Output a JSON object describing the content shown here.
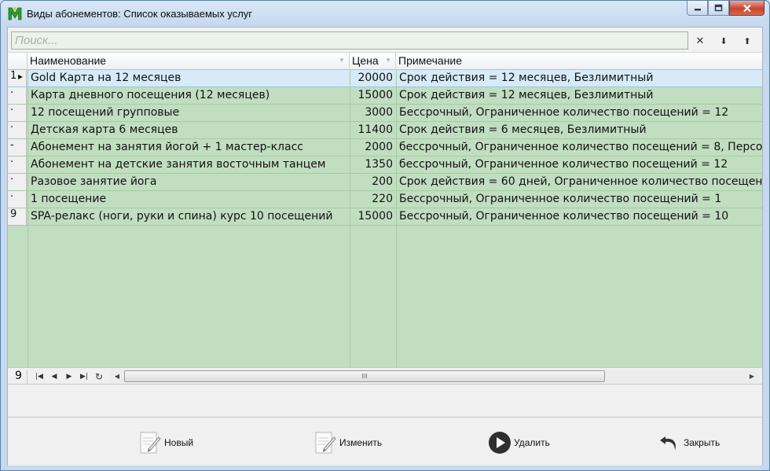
{
  "window": {
    "title": "Виды абонементов: Список оказываемых услуг",
    "app_icon": "app-logo-icon"
  },
  "search": {
    "placeholder": "Поиск...",
    "value": "",
    "clear_glyph": "✕",
    "down_glyph": "⬇",
    "up_glyph": "⬆"
  },
  "grid": {
    "columns": [
      "Наименование",
      "Цена",
      "Примечание"
    ],
    "rows": [
      {
        "indicator": "1",
        "name": "Gold Карта на 12 месяцев",
        "price": "20000",
        "note": "Срок действия = 12 месяцев, Безлимитный",
        "selected": true
      },
      {
        "indicator": "·",
        "name": "Карта дневного посещения (12 месяцев)",
        "price": "15000",
        "note": "Срок действия = 12 месяцев, Безлимитный"
      },
      {
        "indicator": "·",
        "name": "12 посещений групповые",
        "price": "3000",
        "note": "Бессрочный, Ограниченное количество посещений = 12"
      },
      {
        "indicator": "·",
        "name": "Детская карта 6 месяцев",
        "price": "11400",
        "note": "Срок действия = 6 месяцев, Безлимитный"
      },
      {
        "indicator": "-",
        "name": "Абонемент на занятия йогой + 1 мастер-класс",
        "price": "2000",
        "note": "бессрочный, Ограниченное количество посещений = 8, Персо"
      },
      {
        "indicator": "·",
        "name": "Абонемент на детские занятия восточным танцем",
        "price": "1350",
        "note": "бессрочный, Ограниченное количество посещений = 12"
      },
      {
        "indicator": "·",
        "name": "Разовое занятие йога",
        "price": "200",
        "note": "Срок действия = 60 дней, Ограниченное количество посещени"
      },
      {
        "indicator": "·",
        "name": "1 посещение",
        "price": "220",
        "note": "Бессрочный, Ограниченное количество посещений = 1"
      },
      {
        "indicator": "9",
        "name": "SPA-релакс (ноги, руки и спина) курс 10 посещений",
        "price": "15000",
        "note": "Бессрочный, Ограниченное количество посещений = 10"
      }
    ]
  },
  "navigator": {
    "count": "9",
    "scroll_grip": "III"
  },
  "buttons": {
    "new": "Новый",
    "edit": "Изменить",
    "delete": "Удалить",
    "close": "Закрыть"
  },
  "colors": {
    "grid_bg": "#c1dec0",
    "selected_row": "#d6ebf7",
    "search_bg": "#e9f3e7"
  }
}
